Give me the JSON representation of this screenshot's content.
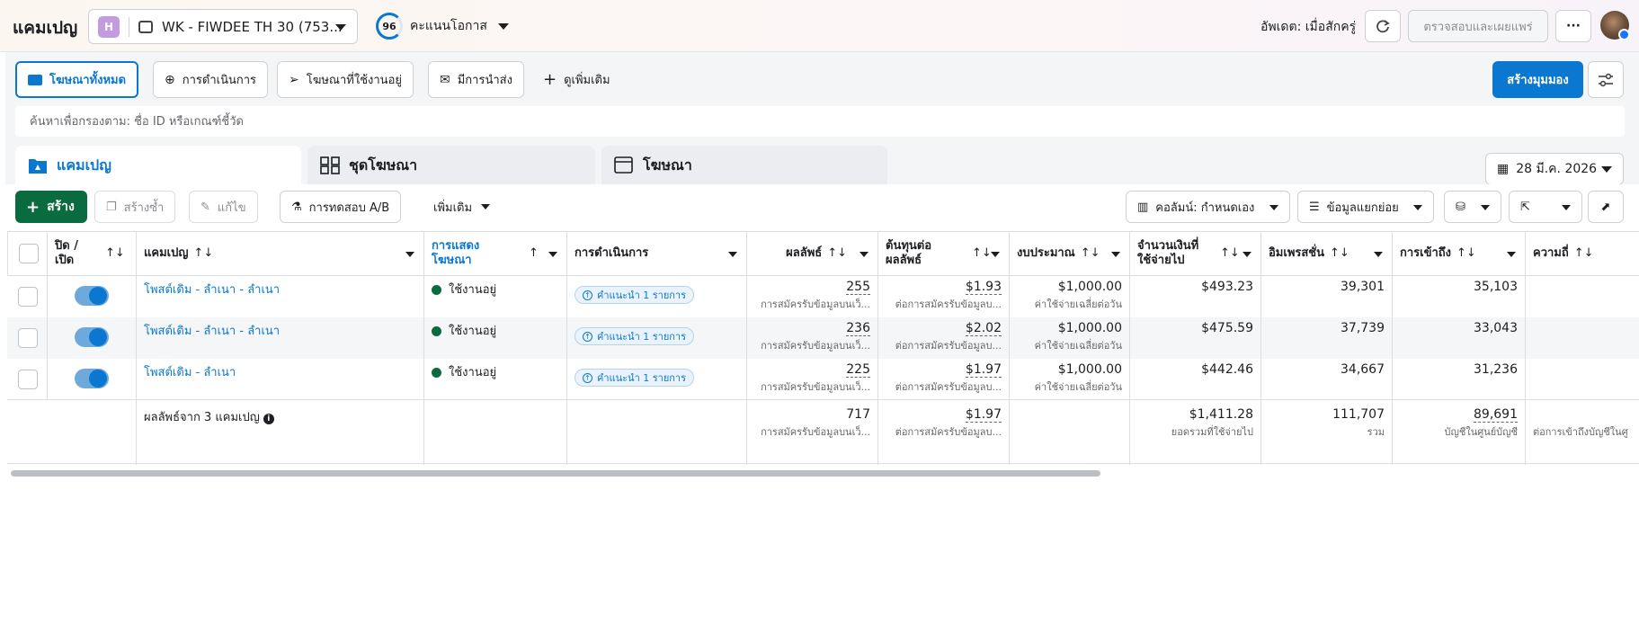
{
  "header": {
    "title": "แคมเปญ",
    "account_badge": "H",
    "account_name": "WK - FIWDEE TH 30 (753...",
    "score_value": "96",
    "score_label": "คะแนนโอกาส",
    "updated": "อัพเดต: เมื่อสักครู่",
    "publish_label": "ตรวจสอบและเผยแพร่",
    "more_label": "···"
  },
  "filters": {
    "all_ads": "โฆษณาทั้งหมด",
    "actions": "การดำเนินการ",
    "active_ads": "โฆษณาที่ใช้งานอยู่",
    "delivery": "มีการนำส่ง",
    "see_more": "ดูเพิ่มเติม",
    "create_view": "สร้างมุมมอง"
  },
  "search": {
    "placeholder": "ค้นหาเพื่อกรองตาม: ชื่อ ID หรือเกณฑ์ชี้วัด"
  },
  "level_tabs": {
    "campaigns": "แคมเปญ",
    "ad_sets": "ชุดโฆษณา",
    "ads": "โฆษณา"
  },
  "date_range": "28 มี.ค. 2026",
  "toolbar": {
    "create": "สร้าง",
    "duplicate": "สร้างซ้ำ",
    "edit": "แก้ไข",
    "ab_test": "การทดสอบ A/B",
    "more": "เพิ่มเติม",
    "columns": "คอลัมน์: กำหนดเอง",
    "breakdown": "ข้อมูลแยกย่อย"
  },
  "columns": {
    "onoff": "ปิด / เปิด",
    "campaign": "แคมเปญ",
    "delivery": "การแสดงโฆษณา",
    "actions": "การดำเนินการ",
    "results": "ผลลัพธ์",
    "cost_per_result": "ต้นทุนต่อผลลัพธ์",
    "budget": "งบประมาณ",
    "amount_spent": "จำนวนเงินที่ใช้จ่ายไป",
    "impressions": "อิมเพรสชั่น",
    "reach": "การเข้าถึง",
    "frequency": "ความถี่"
  },
  "rows": [
    {
      "name": "โพสต์เดิม - ลำเนา - ลำเนา",
      "status": "ใช้งานอยู่",
      "recommendation": "คำแนะนำ 1 รายการ",
      "results": "255",
      "results_sub": "การสมัครรับข้อมูลบนเว็...",
      "cost": "$1.93",
      "cost_sub": "ต่อการสมัครรับข้อมูลบ...",
      "budget": "$1,000.00",
      "budget_sub": "ค่าใช้จ่ายเฉลี่ยต่อวัน",
      "spent": "$493.23",
      "impressions": "39,301",
      "reach": "35,103"
    },
    {
      "name": "โพสต์เดิม - ลำเนา - ลำเนา",
      "status": "ใช้งานอยู่",
      "recommendation": "คำแนะนำ 1 รายการ",
      "results": "236",
      "results_sub": "การสมัครรับข้อมูลบนเว็...",
      "cost": "$2.02",
      "cost_sub": "ต่อการสมัครรับข้อมูลบ...",
      "budget": "$1,000.00",
      "budget_sub": "ค่าใช้จ่ายเฉลี่ยต่อวัน",
      "spent": "$475.59",
      "impressions": "37,739",
      "reach": "33,043"
    },
    {
      "name": "โพสต์เดิม - ลำเนา",
      "status": "ใช้งานอยู่",
      "recommendation": "คำแนะนำ 1 รายการ",
      "results": "225",
      "results_sub": "การสมัครรับข้อมูลบนเว็...",
      "cost": "$1.97",
      "cost_sub": "ต่อการสมัครรับข้อมูลบ...",
      "budget": "$1,000.00",
      "budget_sub": "ค่าใช้จ่ายเฉลี่ยต่อวัน",
      "spent": "$442.46",
      "impressions": "34,667",
      "reach": "31,236"
    }
  ],
  "totals": {
    "label": "ผลลัพธ์จาก 3 แคมเปญ",
    "results": "717",
    "results_sub": "การสมัครรับข้อมูลบนเว็...",
    "cost": "$1.97",
    "cost_sub": "ต่อการสมัครรับข้อมูลบ...",
    "spent": "$1,411.28",
    "spent_sub": "ยอดรวมที่ใช้จ่ายไป",
    "impressions": "111,707",
    "impressions_sub": "รวม",
    "reach": "89,691",
    "reach_sub": "บัญชีในศูนย์บัญชี",
    "frequency_sub": "ต่อการเข้าถึงบัญชีในศู"
  }
}
